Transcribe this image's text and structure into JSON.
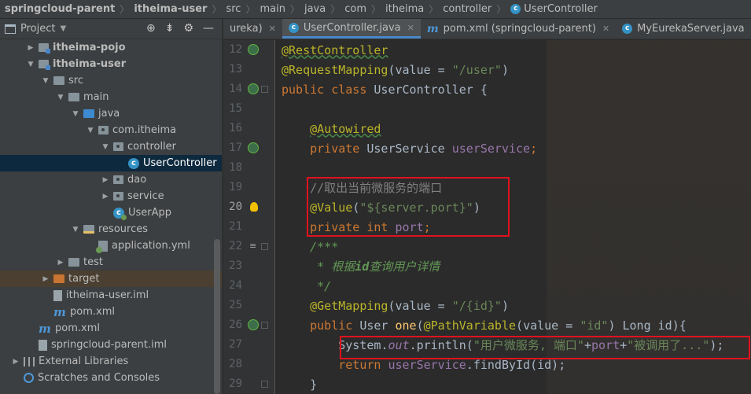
{
  "breadcrumb": [
    "springcloud-parent",
    "itheima-user",
    "src",
    "main",
    "java",
    "com",
    "itheima",
    "controller",
    "UserController"
  ],
  "project_panel": {
    "title": "Project",
    "tools": [
      "target-icon",
      "collapse-icon",
      "gear-icon",
      "minimize-icon"
    ],
    "tree": [
      {
        "label": "itheima-pojo",
        "depth": 1,
        "arrow": "collapsed",
        "icon": "module-icon",
        "bold": true
      },
      {
        "label": "itheima-user",
        "depth": 1,
        "arrow": "expanded",
        "icon": "module-icon",
        "bold": true
      },
      {
        "label": "src",
        "depth": 2,
        "arrow": "expanded",
        "icon": "folder-icon"
      },
      {
        "label": "main",
        "depth": 3,
        "arrow": "expanded",
        "icon": "folder-icon"
      },
      {
        "label": "java",
        "depth": 4,
        "arrow": "expanded",
        "icon": "source-folder-icon"
      },
      {
        "label": "com.itheima",
        "depth": 5,
        "arrow": "expanded",
        "icon": "package-icon"
      },
      {
        "label": "controller",
        "depth": 6,
        "arrow": "expanded",
        "icon": "package-icon"
      },
      {
        "label": "UserController",
        "depth": 7,
        "arrow": "none",
        "icon": "class-icon",
        "selected": true
      },
      {
        "label": "dao",
        "depth": 6,
        "arrow": "collapsed",
        "icon": "package-icon"
      },
      {
        "label": "service",
        "depth": 6,
        "arrow": "collapsed",
        "icon": "package-icon"
      },
      {
        "label": "UserApp",
        "depth": 6,
        "arrow": "none",
        "icon": "spring-class-icon"
      },
      {
        "label": "resources",
        "depth": 4,
        "arrow": "expanded",
        "icon": "resources-folder-icon"
      },
      {
        "label": "application.yml",
        "depth": 5,
        "arrow": "none",
        "icon": "yml-icon"
      },
      {
        "label": "test",
        "depth": 3,
        "arrow": "collapsed",
        "icon": "folder-icon"
      },
      {
        "label": "target",
        "depth": 2,
        "arrow": "collapsed",
        "icon": "excluded-folder-icon",
        "excluded": true
      },
      {
        "label": "itheima-user.iml",
        "depth": 2,
        "arrow": "none",
        "icon": "iml-file-icon"
      },
      {
        "label": "pom.xml",
        "depth": 2,
        "arrow": "none",
        "icon": "maven-icon"
      },
      {
        "label": "pom.xml",
        "depth": 1,
        "arrow": "none",
        "icon": "maven-icon"
      },
      {
        "label": "springcloud-parent.iml",
        "depth": 1,
        "arrow": "none",
        "icon": "iml-file-icon"
      },
      {
        "label": "External Libraries",
        "depth": 0,
        "arrow": "collapsed",
        "icon": "libraries-icon"
      },
      {
        "label": "Scratches and Consoles",
        "depth": 0,
        "arrow": "none",
        "icon": "scratches-icon"
      }
    ]
  },
  "tabs": [
    {
      "label": "ureka)",
      "icon": "",
      "active": false
    },
    {
      "label": "UserController.java",
      "icon": "class",
      "active": true
    },
    {
      "label": "pom.xml (springcloud-parent)",
      "icon": "maven",
      "active": false
    },
    {
      "label": "MyEurekaServer.java",
      "icon": "class",
      "active": false
    },
    {
      "label": "U",
      "icon": "class",
      "active": false
    }
  ],
  "editor": {
    "current_line": 20,
    "lines": [
      {
        "n": 12,
        "gutter": "bean"
      },
      {
        "n": 13,
        "gutter": ""
      },
      {
        "n": 14,
        "gutter": "bean"
      },
      {
        "n": 15,
        "gutter": ""
      },
      {
        "n": 16,
        "gutter": ""
      },
      {
        "n": 17,
        "gutter": "bean"
      },
      {
        "n": 18,
        "gutter": ""
      },
      {
        "n": 19,
        "gutter": ""
      },
      {
        "n": 20,
        "gutter": "bulb"
      },
      {
        "n": 21,
        "gutter": ""
      },
      {
        "n": 22,
        "gutter": "list"
      },
      {
        "n": 23,
        "gutter": ""
      },
      {
        "n": 24,
        "gutter": ""
      },
      {
        "n": 25,
        "gutter": ""
      },
      {
        "n": 26,
        "gutter": "bean"
      },
      {
        "n": 27,
        "gutter": ""
      },
      {
        "n": 28,
        "gutter": ""
      },
      {
        "n": 29,
        "gutter": ""
      }
    ],
    "code": {
      "l12": "@RestController",
      "l13_ann": "@RequestMapping",
      "l13_p1": "(",
      "l13_attr": "value",
      "l13_eq": " = ",
      "l13_str": "\"/user\"",
      "l13_p2": ")",
      "l14_kw": "public class ",
      "l14_name": "UserController {",
      "l16": "@Autowired",
      "l17_kw": "private ",
      "l17_type": "UserService ",
      "l17_fld": "userService",
      "l17_semi": ";",
      "l19": "//取出当前微服务的端口",
      "l20_ann": "@Value",
      "l20_p1": "(",
      "l20_str": "\"${server.port}\"",
      "l20_p2": ")",
      "l21_kw": "private int ",
      "l21_fld": "port",
      "l21_semi": ";",
      "l22": "/***",
      "l23_star": " * ",
      "l23_a": "根据",
      "l23_b": "id",
      "l23_c": "查询用户详情",
      "l24": " */",
      "l25_ann": "@GetMapping",
      "l25_p1": "(",
      "l25_attr": "value",
      "l25_eq": " = ",
      "l25_str": "\"/{id}\"",
      "l25_p2": ")",
      "l26_kw": "public ",
      "l26_type": "User ",
      "l26_fn": "one",
      "l26_p1": "(",
      "l26_ann": "@PathVariable",
      "l26_p2": "(",
      "l26_attr": "value",
      "l26_eq": " = ",
      "l26_str": "\"id\"",
      "l26_rest": ") Long id){",
      "l27_a": "System.",
      "l27_out": "out",
      "l27_b": ".println(",
      "l27_s1": "\"用户微服务, 端口\"",
      "l27_plus1": "+",
      "l27_port": "port",
      "l27_plus2": "+",
      "l27_s2": "\"被调用了...\"",
      "l27_end": ");",
      "l28_kw": "return ",
      "l28_fld": "userService",
      "l28_rest": ".findById(id);",
      "l29": "}"
    }
  },
  "colors": {
    "highlight_box": "#e0121e",
    "keyword": "#cc7832",
    "annotation": "#bbb529",
    "string": "#6a8759",
    "field": "#9876aa"
  }
}
